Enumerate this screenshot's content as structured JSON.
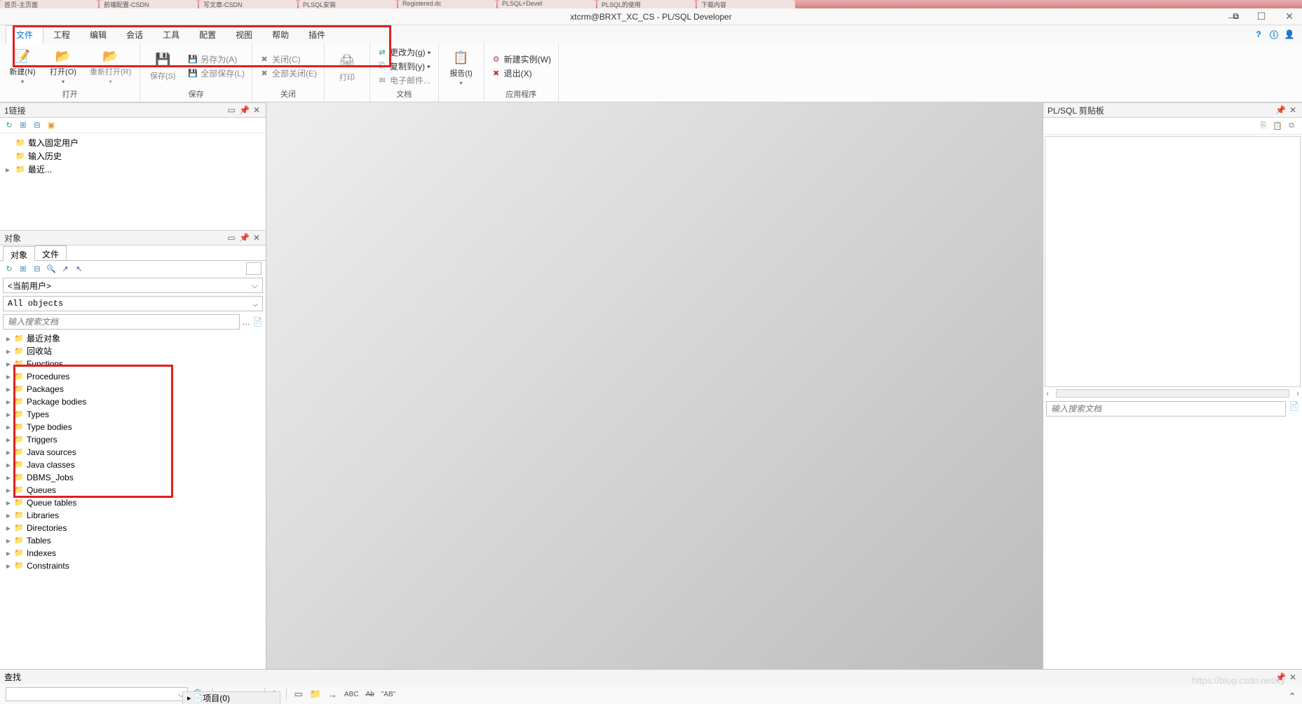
{
  "browser_tabs": [
    "首页-主页面",
    "前端配置-CSDN",
    "写文章-CSDN",
    "PLSQL安装",
    "Registered.dc",
    "PLSQL+Devel",
    "PLSQL的使用",
    "下载内容"
  ],
  "title": "xtcrm@BRXT_XC_CS - PL/SQL Developer",
  "menu": {
    "file": "文件",
    "project": "工程",
    "edit": "编辑",
    "session": "会话",
    "tools": "工具",
    "config": "配置",
    "view": "视图",
    "help": "帮助",
    "plugin": "插件"
  },
  "ribbon": {
    "open_group": "打开",
    "new": "新建(N)",
    "open": "打开(O)",
    "reopen": "重新打开(R)",
    "save_group": "保存",
    "save": "保存(S)",
    "saveas": "另存为(A)",
    "saveall": "全部保存(L)",
    "close_group": "关闭",
    "close": "关闭(C)",
    "closeall": "全部关闭(E)",
    "print_group": "",
    "print": "打印",
    "doc_group": "文档",
    "changeto": "更改为(g)",
    "copyto": "复制到(y)",
    "email": "电子邮件...",
    "report": "报告(t)",
    "app_group": "应用程序",
    "newinst": "新建实例(W)",
    "exit": "退出(X)"
  },
  "panels": {
    "connections": {
      "title": "1链接",
      "items": [
        "载入固定用户",
        "输入历史",
        "最近..."
      ]
    },
    "objects": {
      "title": "对象",
      "tab1": "对象",
      "tab2": "文件",
      "user_combo": "<当前用户>",
      "filter_combo": "All objects",
      "search_placeholder": "输入搜索文档",
      "dots": "...",
      "tree": [
        "最近对象",
        "回收站",
        "Functions",
        "Procedures",
        "Packages",
        "Package bodies",
        "Types",
        "Type bodies",
        "Triggers",
        "Java sources",
        "Java classes",
        "DBMS_Jobs",
        "Queues",
        "Queue tables",
        "Libraries",
        "Directories",
        "Tables",
        "Indexes",
        "Constraints"
      ]
    },
    "clipboard": {
      "title": "PL/SQL 剪贴板",
      "search_placeholder": "输入搜索文档"
    },
    "find": {
      "title": "查找"
    }
  },
  "status_stub": "项目(0)",
  "watermark": "https://blog.csdn.net/xy"
}
